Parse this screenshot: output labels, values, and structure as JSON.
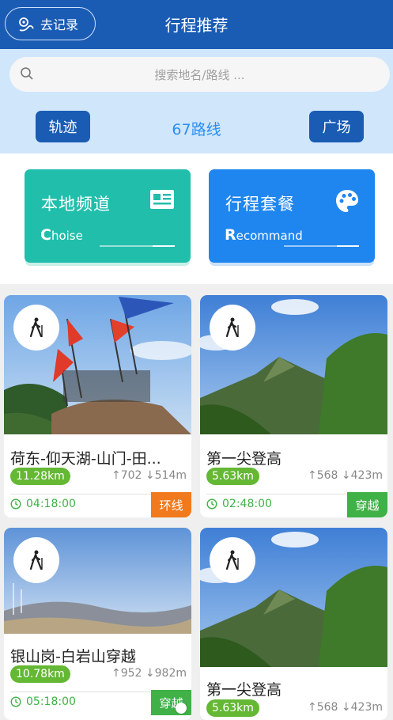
{
  "header": {
    "back_label": "去记录",
    "title": "行程推荐"
  },
  "search": {
    "placeholder": "搜索地名/路线 ..."
  },
  "tabs": {
    "left": "轨迹",
    "count": "67路线",
    "right": "广场"
  },
  "channels": [
    {
      "title": "本地频道",
      "sub_first": "C",
      "sub_rest": "hoise",
      "icon": "news-card-icon"
    },
    {
      "title": "行程套餐",
      "sub_first": "R",
      "sub_rest": "ecommand",
      "icon": "palette-icon"
    }
  ],
  "routes": [
    {
      "title": "荷东-仰天湖-山门-田...",
      "distance": "11.28km",
      "ascent": "702",
      "descent": "514m",
      "duration": "04:18:00",
      "tag": "环线",
      "tag_color": "#f07a1d"
    },
    {
      "title": "第一尖登高",
      "distance": "5.63km",
      "ascent": "568",
      "descent": "423m",
      "duration": "02:48:00",
      "tag": "穿越",
      "tag_color": "#3fb146"
    },
    {
      "title": "银山岗-白岩山穿越",
      "distance": "10.78km",
      "ascent": "952",
      "descent": "982m",
      "duration": "05:18:00",
      "tag": "穿越",
      "tag_color": "#3fb146"
    },
    {
      "title": "第一尖登高",
      "distance": "5.63km",
      "ascent": "568",
      "descent": "423m"
    }
  ],
  "colors": {
    "primary": "#1a5cb4",
    "accent": "#2a8ef0",
    "teal": "#22beac",
    "blue": "#1f86ef",
    "green": "#64b834"
  }
}
